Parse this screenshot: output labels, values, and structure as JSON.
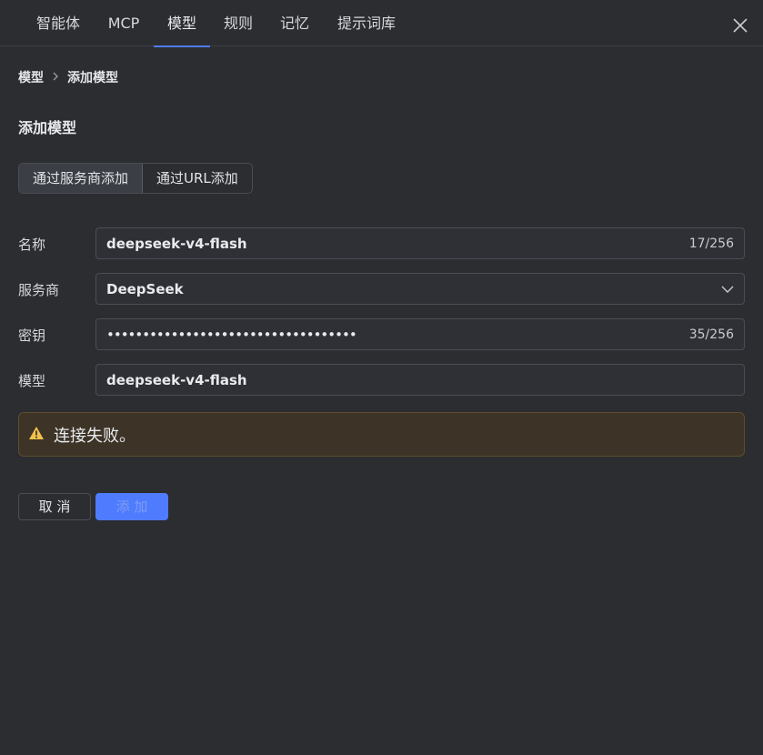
{
  "tabs": [
    {
      "label": "智能体"
    },
    {
      "label": "MCP"
    },
    {
      "label": "模型"
    },
    {
      "label": "规则"
    },
    {
      "label": "记忆"
    },
    {
      "label": "提示词库"
    }
  ],
  "active_tab": "模型",
  "breadcrumb": {
    "root": "模型",
    "current": "添加模型"
  },
  "page_title": "添加模型",
  "add_mode": {
    "options": [
      "通过服务商添加",
      "通过URL添加"
    ],
    "selected": "通过服务商添加"
  },
  "form": {
    "name": {
      "label": "名称",
      "value": "deepseek-v4-flash",
      "count": "17/256"
    },
    "provider": {
      "label": "服务商",
      "value": "DeepSeek"
    },
    "key": {
      "label": "密钥",
      "value": "•••••••••••••••••••••••••••••••••••",
      "count": "35/256"
    },
    "model": {
      "label": "模型",
      "value": "deepseek-v4-flash"
    }
  },
  "alert": {
    "message": "连接失败。",
    "icon": "warning-icon",
    "color": "#f0c14b"
  },
  "buttons": {
    "cancel": "取 消",
    "add": "添 加"
  },
  "colors": {
    "accent": "#4f7cff",
    "background": "#2b2d31",
    "alert_bg": "#3d3427"
  }
}
